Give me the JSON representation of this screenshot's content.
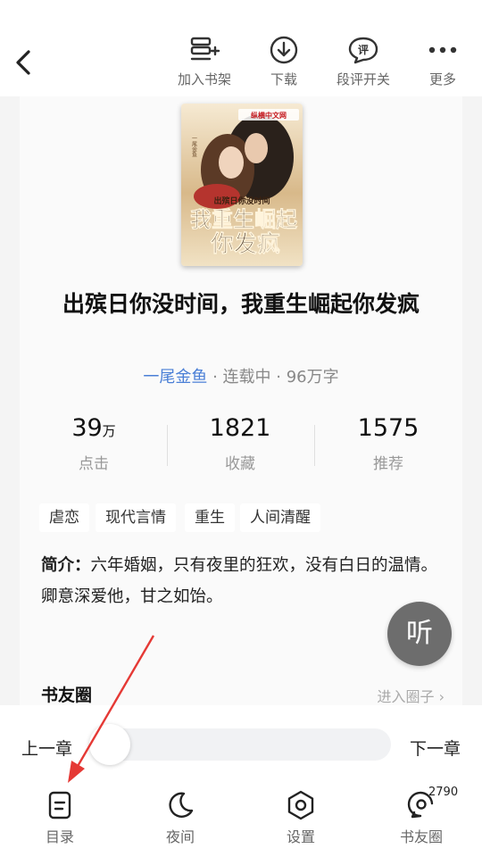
{
  "topbar": {
    "back_icon": "chevron-left-icon",
    "actions": [
      {
        "label": "加入书架",
        "icon": "add-bookshelf-icon"
      },
      {
        "label": "下载",
        "icon": "download-icon"
      },
      {
        "label": "段评开关",
        "icon": "comment-toggle-icon"
      },
      {
        "label": "更多",
        "icon": "more-icon"
      }
    ]
  },
  "cover": {
    "publisher": "纵横中文网",
    "title_line1": "出殡日你没时间",
    "title_line2": "我重生崛起",
    "title_line3": "你发疯",
    "author_mark": "一尾金鱼"
  },
  "book": {
    "title": "出殡日你没时间，我重生崛起你发疯",
    "author": "一尾金鱼",
    "status_words": " · 连载中 · 96万字"
  },
  "stats": [
    {
      "value": "39",
      "unit": "万",
      "label": "点击"
    },
    {
      "value": "1821",
      "unit": "",
      "label": "收藏"
    },
    {
      "value": "1575",
      "unit": "",
      "label": "推荐"
    }
  ],
  "tags": [
    "虐恋",
    "现代言情",
    "重生",
    "人间清醒"
  ],
  "intro": {
    "label": "简介：",
    "line1": "六年婚姻，只有夜里的狂欢，没有白日的温情。",
    "line2": "卿意深爱他，甘之如饴。"
  },
  "circle": {
    "title": "书友圈",
    "link": "进入圈子 ›"
  },
  "listen_label": "听",
  "chapter_nav": {
    "prev": "上一章",
    "next": "下一章"
  },
  "bottom_nav": [
    {
      "label": "目录",
      "icon": "catalog-icon"
    },
    {
      "label": "夜间",
      "icon": "moon-icon"
    },
    {
      "label": "设置",
      "icon": "settings-icon"
    },
    {
      "label": "书友圈",
      "icon": "book-circle-icon"
    }
  ],
  "badge_count": "2790",
  "colors": {
    "accent": "#4a7fd6",
    "arrow": "#e53935"
  }
}
